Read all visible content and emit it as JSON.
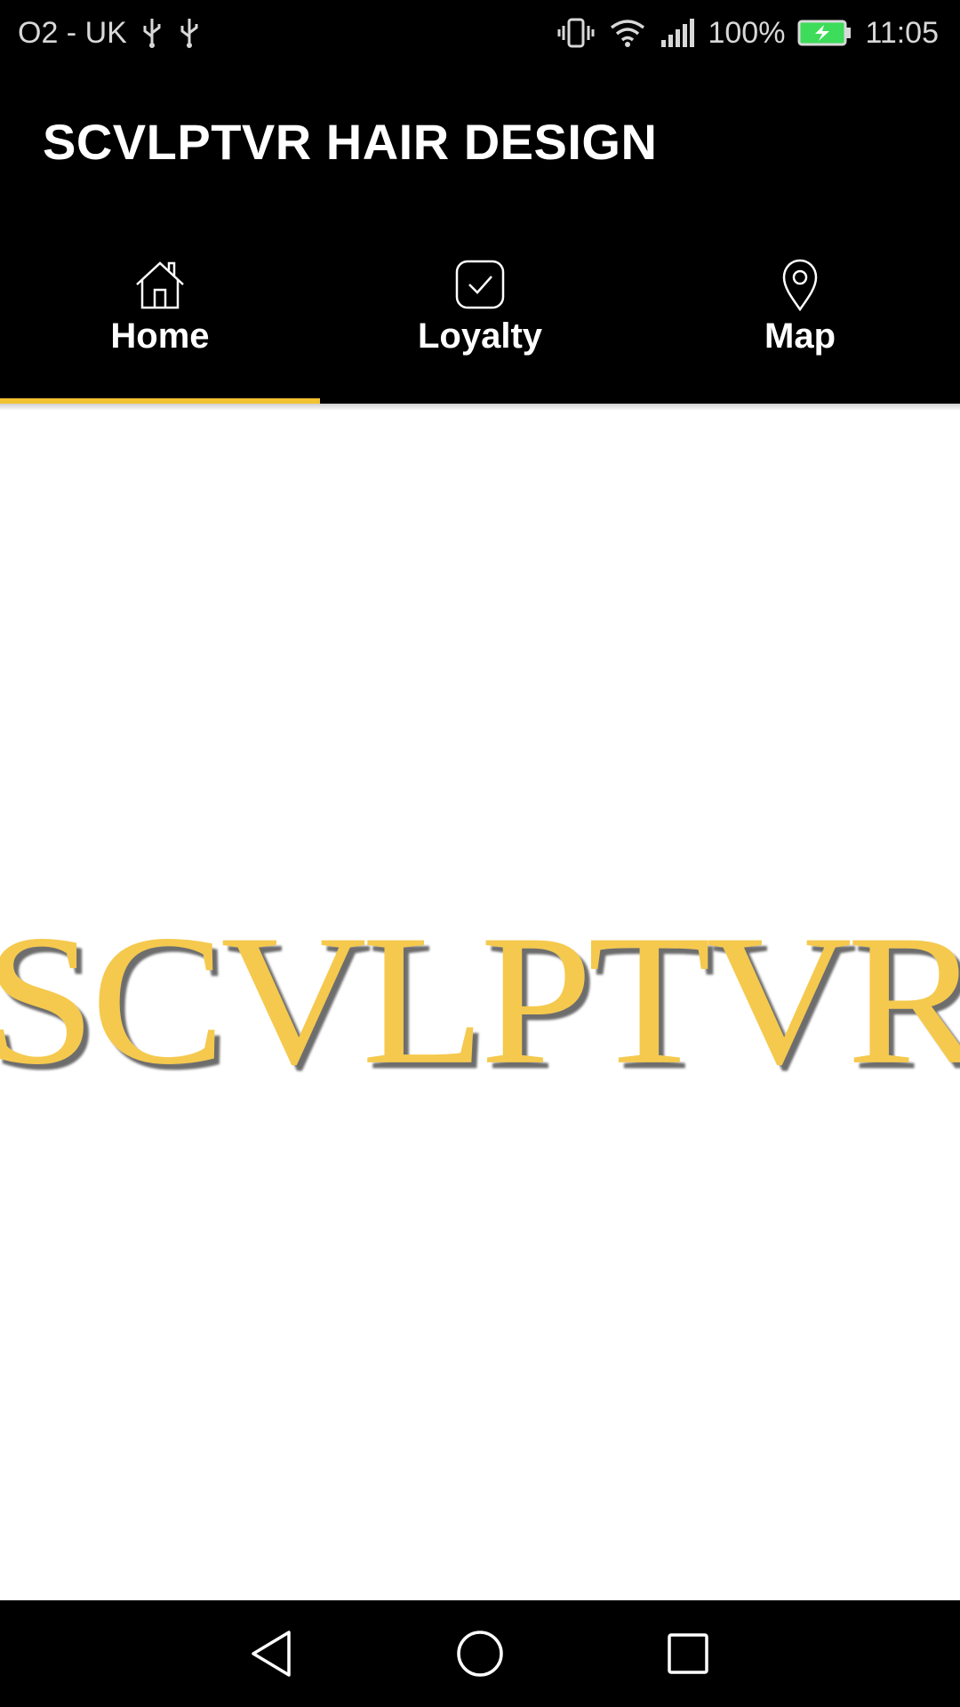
{
  "status_bar": {
    "carrier": "O2 - UK",
    "battery_percent": "100%",
    "time": "11:05",
    "icons": [
      "usb-icon",
      "usb-icon",
      "vibrate-icon",
      "wifi-icon",
      "signal-icon",
      "battery-charging-icon"
    ]
  },
  "app_bar": {
    "title": "SCVLPTVR HAIR DESIGN"
  },
  "tabs": [
    {
      "label": "Home",
      "icon": "home-icon",
      "selected": true
    },
    {
      "label": "Loyalty",
      "icon": "checkbox-icon",
      "selected": false
    },
    {
      "label": "Map",
      "icon": "map-pin-icon",
      "selected": false
    }
  ],
  "content": {
    "logo_text": "SCVLPTVR"
  },
  "nav_bar": {
    "buttons": [
      "back-icon",
      "home-circle-icon",
      "recents-icon"
    ]
  },
  "colors": {
    "accent": "#f2c230",
    "logo_gold": "#f5c94e",
    "bar_background": "#000000",
    "battery_green": "#3ddc5a"
  }
}
